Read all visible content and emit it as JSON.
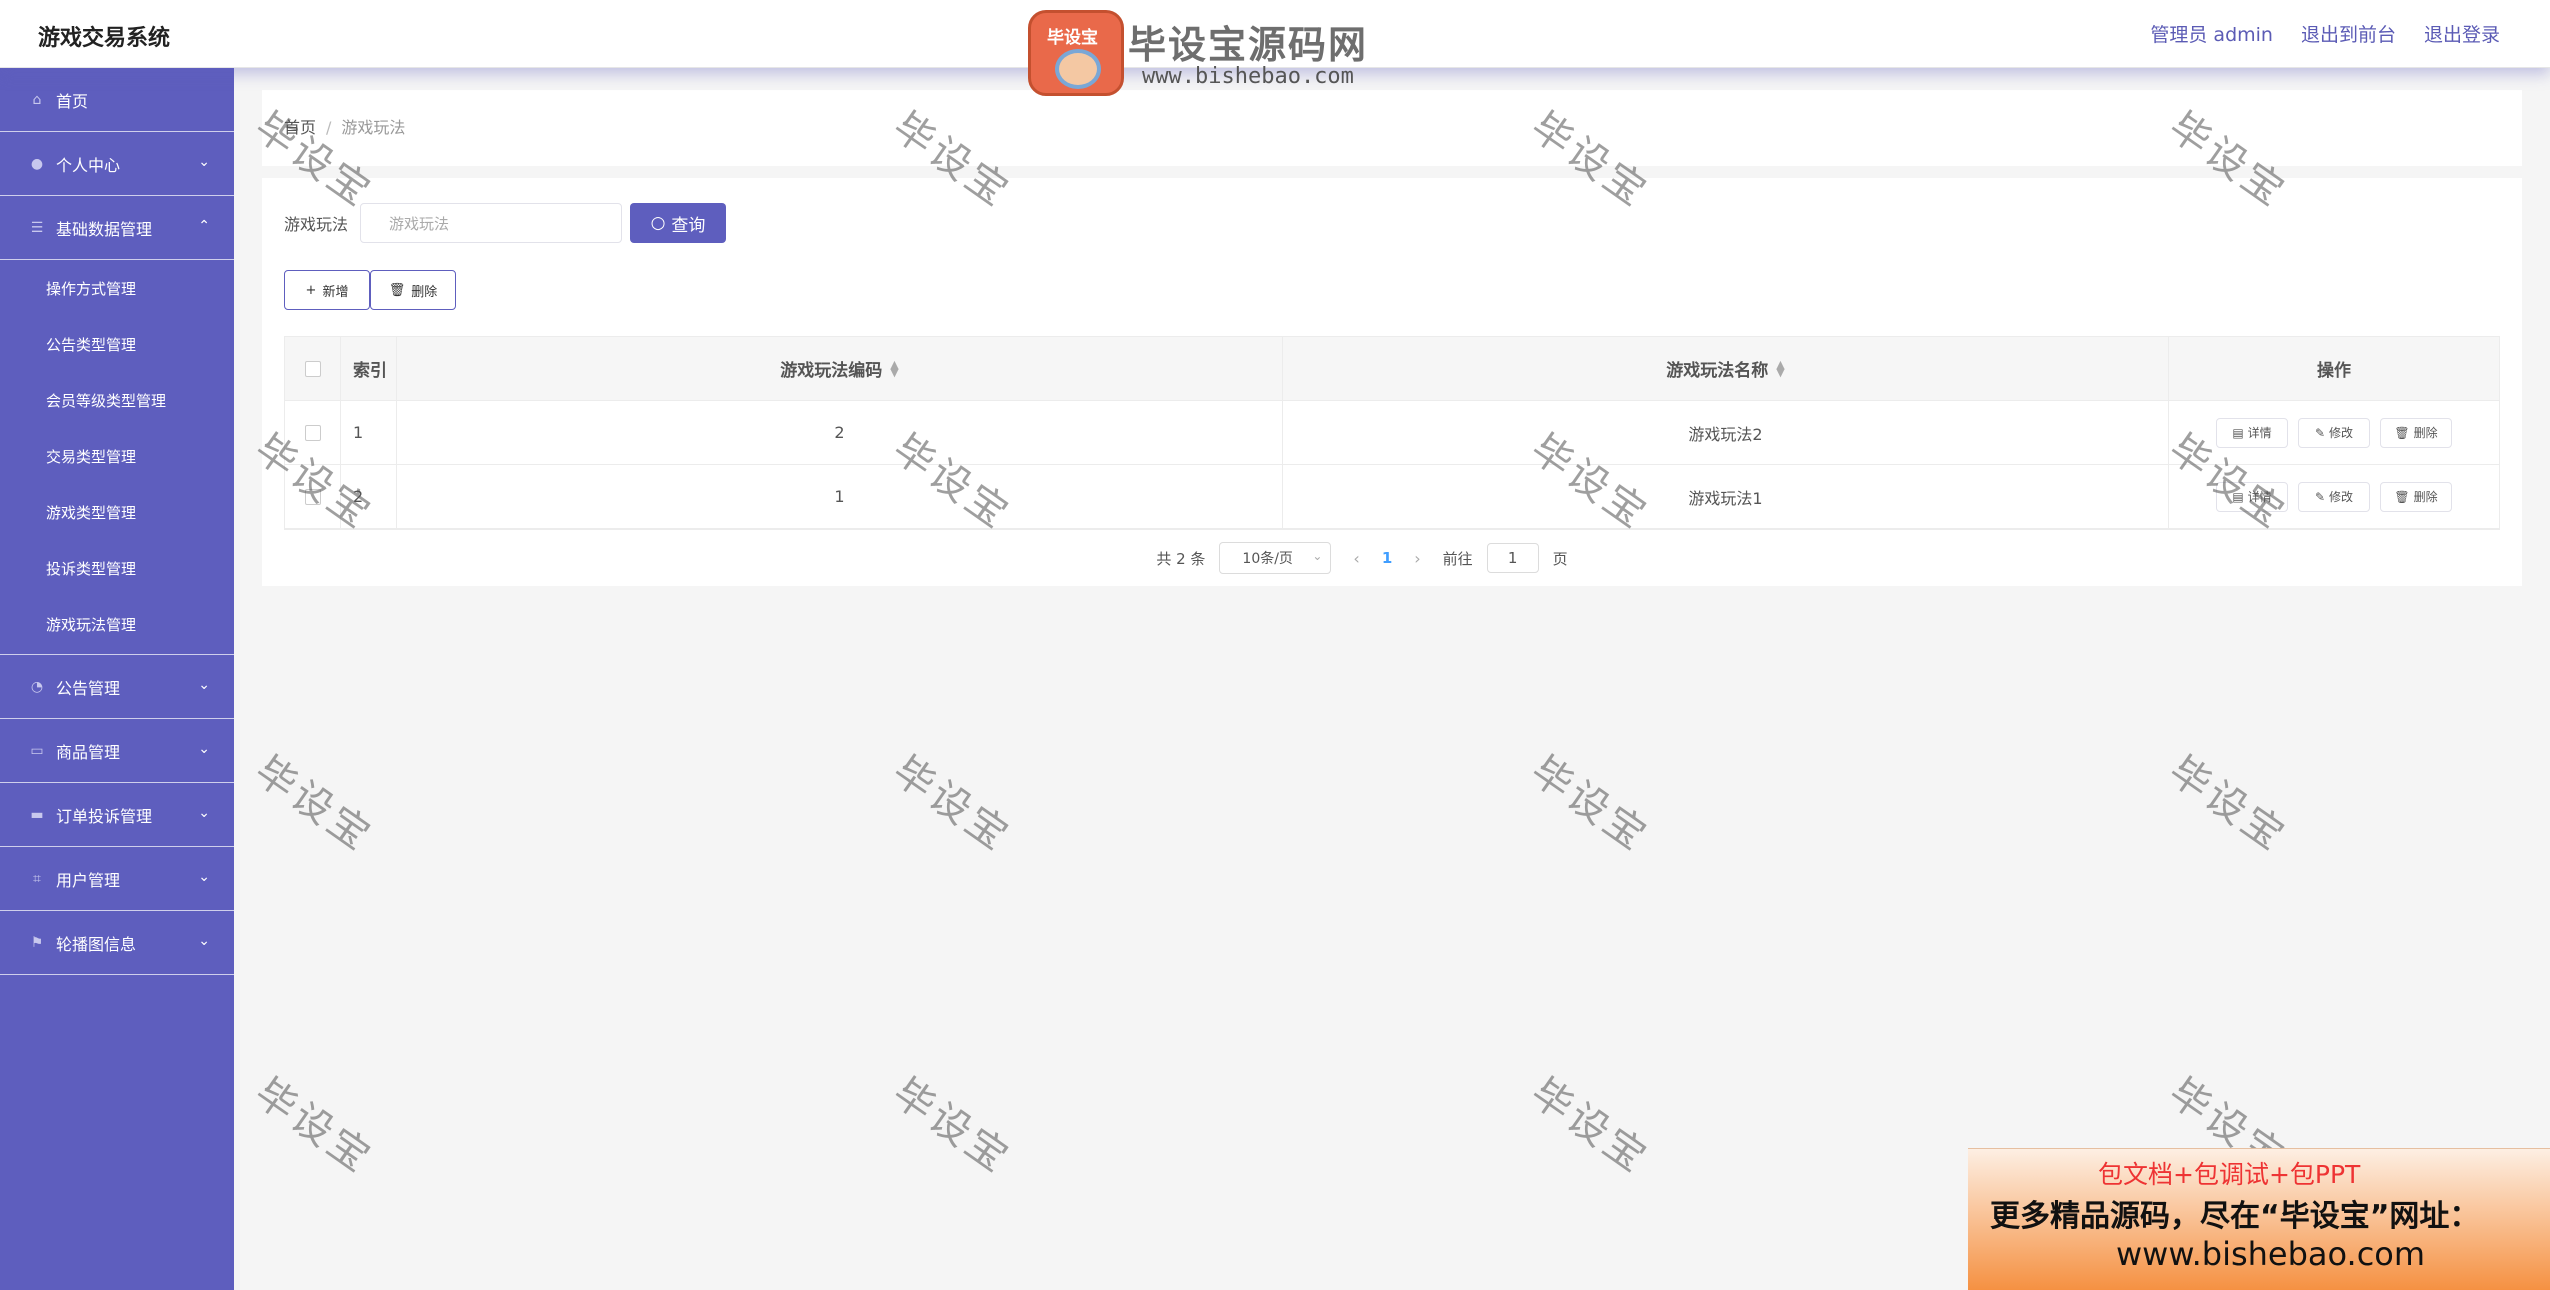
{
  "header": {
    "app_title": "游戏交易系统",
    "admin_label": "管理员 admin",
    "front_link": "退出到前台",
    "logout_link": "退出登录"
  },
  "logo": {
    "badge_text": "毕设宝",
    "main_text": "毕设宝源码网",
    "url_text": "www.bishebao.com"
  },
  "sidebar": {
    "items": [
      {
        "label": "首页",
        "icon": "home-icon"
      },
      {
        "label": "个人中心",
        "icon": "user-icon"
      },
      {
        "label": "基础数据管理",
        "icon": "list-icon"
      },
      {
        "label": "公告管理",
        "icon": "dashboard-icon"
      },
      {
        "label": "商品管理",
        "icon": "message-icon"
      },
      {
        "label": "订单投诉管理",
        "icon": "monitor-icon"
      },
      {
        "label": "用户管理",
        "icon": "crop-icon"
      },
      {
        "label": "轮播图信息",
        "icon": "flag-icon"
      }
    ],
    "submenu": [
      "操作方式管理",
      "公告类型管理",
      "会员等级类型管理",
      "交易类型管理",
      "游戏类型管理",
      "投诉类型管理",
      "游戏玩法管理"
    ]
  },
  "breadcrumb": {
    "home": "首页",
    "separator": "/",
    "current": "游戏玩法"
  },
  "search": {
    "label": "游戏玩法",
    "placeholder": "游戏玩法",
    "button": "查询"
  },
  "actions": {
    "add": "新增",
    "delete": "删除"
  },
  "table": {
    "headers": {
      "index": "索引",
      "code": "游戏玩法编码",
      "name": "游戏玩法名称",
      "ops": "操作"
    },
    "rows": [
      {
        "index": "1",
        "code": "2",
        "name": "游戏玩法2"
      },
      {
        "index": "2",
        "code": "1",
        "name": "游戏玩法1"
      }
    ],
    "op_labels": {
      "detail": "详情",
      "edit": "修改",
      "delete": "删除"
    }
  },
  "pagination": {
    "total": "共 2 条",
    "page_size": "10条/页",
    "current_page": "1",
    "goto_prefix": "前往",
    "goto_value": "1",
    "goto_suffix": "页"
  },
  "watermark": "毕设宝",
  "ad": {
    "line1": "包文档+包调试+包PPT",
    "line2": "更多精品源码，尽在“毕设宝”网址：",
    "line3": "www.bishebao.com"
  },
  "colors": {
    "accent": "#5e5ebe",
    "pager_active": "#409eff"
  }
}
